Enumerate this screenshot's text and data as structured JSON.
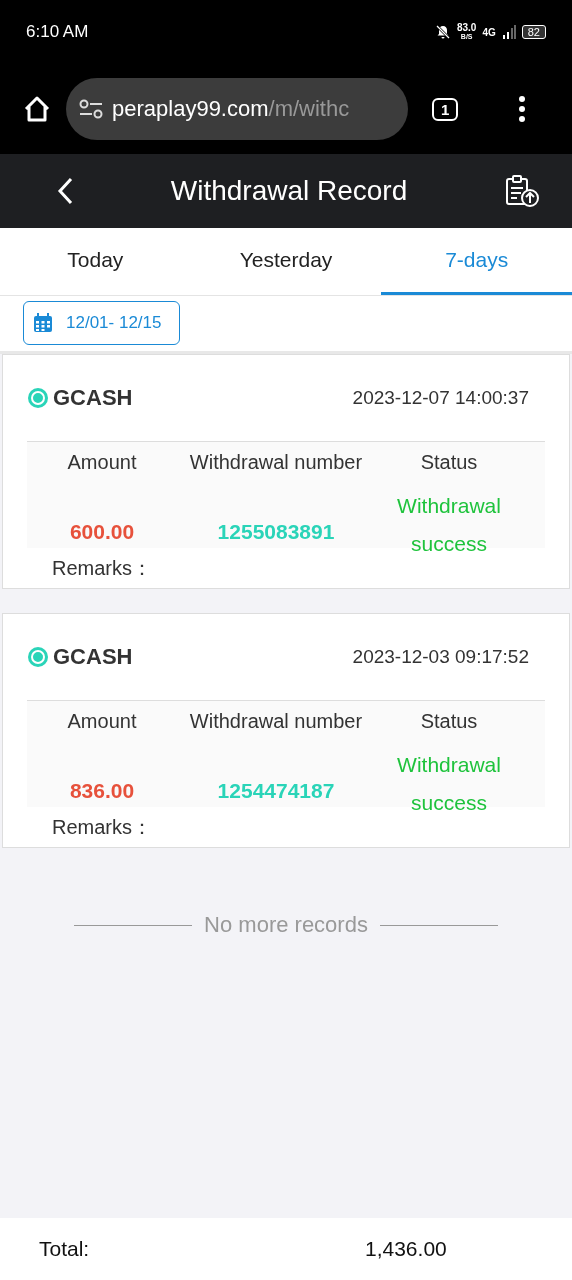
{
  "status_bar": {
    "time": "6:10 AM",
    "speed": "83.0",
    "speed_unit": "B/S",
    "network": "4G",
    "battery": "82"
  },
  "browser": {
    "url_host": "peraplay99.com",
    "url_path": "/m/withc",
    "tab_count": "1"
  },
  "header": {
    "title": "Withdrawal Record"
  },
  "tabs": [
    {
      "label": "Today",
      "selected": false
    },
    {
      "label": "Yesterday",
      "selected": false
    },
    {
      "label": "7-days",
      "selected": true
    }
  ],
  "date_range": "12/01- 12/15",
  "records": [
    {
      "method": "GCASH",
      "datetime": "2023-12-07 14:00:37",
      "columns": [
        "Amount",
        "Withdrawal number",
        "Status"
      ],
      "amount": "600.00",
      "number": "1255083891",
      "status": "Withdrawal success",
      "remarks_label": "Remarks："
    },
    {
      "method": "GCASH",
      "datetime": "2023-12-03 09:17:52",
      "columns": [
        "Amount",
        "Withdrawal number",
        "Status"
      ],
      "amount": "836.00",
      "number": "1254474187",
      "status": "Withdrawal success",
      "remarks_label": "Remarks："
    }
  ],
  "end_message": "No more records",
  "total": {
    "label": "Total:",
    "value": "1,436.00"
  }
}
